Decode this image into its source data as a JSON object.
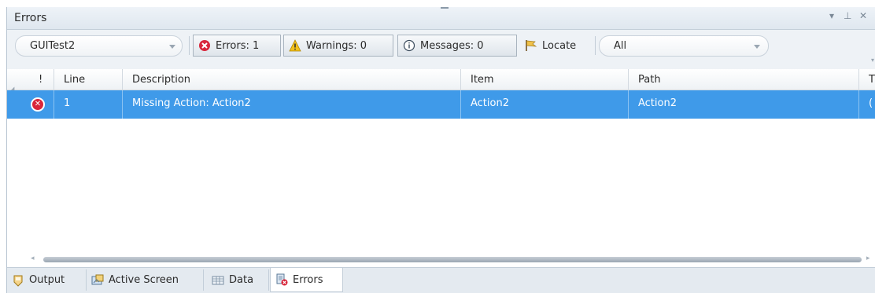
{
  "pane": {
    "title": "Errors"
  },
  "titlebar": {
    "menu_icon": "▾",
    "pin_icon": "⊥",
    "close_icon": "✕"
  },
  "toolbar": {
    "test_combo": {
      "value": "GUITest2"
    },
    "errors_filter": {
      "label": "Errors: 1"
    },
    "warnings_filter": {
      "label": "Warnings: 0"
    },
    "messages_filter": {
      "label": "Messages: 0"
    },
    "locate_button": {
      "label": "Locate"
    },
    "scope_combo": {
      "value": "All"
    }
  },
  "grid": {
    "columns": [
      "!",
      "Line",
      "Description",
      "Item",
      "Path",
      "T"
    ],
    "rows": [
      {
        "line": "1",
        "description": "Missing Action: Action2",
        "item": "Action2",
        "path": "Action2",
        "type": "("
      }
    ]
  },
  "tabs": [
    {
      "label": "Output",
      "icon": "output-icon"
    },
    {
      "label": "Active Screen",
      "icon": "active-screen-icon"
    },
    {
      "label": "Data",
      "icon": "data-icon"
    },
    {
      "label": "Errors",
      "icon": "errors-icon",
      "active": true
    }
  ],
  "colors": {
    "selected_row": "#3f9ae9",
    "error_red": "#d8263b"
  }
}
